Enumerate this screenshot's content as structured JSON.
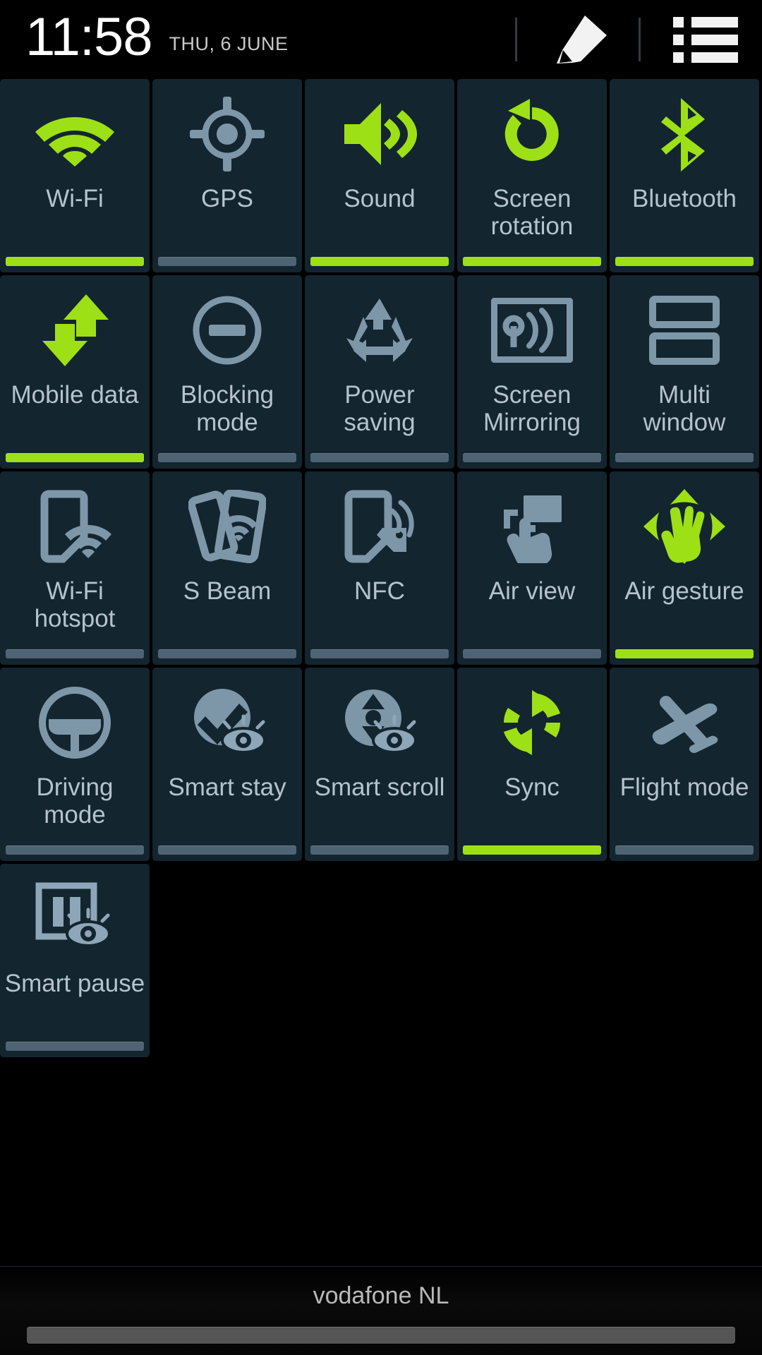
{
  "statusbar": {
    "time": "11:58",
    "date": "THU, 6 JUNE",
    "edit_icon": "pencil-icon",
    "list_icon": "list-icon"
  },
  "colors": {
    "accent_green": "#9ee016",
    "tile_background": "#13252f",
    "inactive_bar": "#4e6373",
    "label_text": "#b6c3cc",
    "screen_background": "#000000"
  },
  "tiles": [
    {
      "label": "Wi-Fi",
      "icon": "wifi-icon",
      "state": "on"
    },
    {
      "label": "GPS",
      "icon": "gps-icon",
      "state": "off"
    },
    {
      "label": "Sound",
      "icon": "sound-icon",
      "state": "on"
    },
    {
      "label": "Screen rotation",
      "icon": "screen-rotation-icon",
      "state": "on"
    },
    {
      "label": "Bluetooth",
      "icon": "bluetooth-icon",
      "state": "on"
    },
    {
      "label": "Mobile data",
      "icon": "mobile-data-icon",
      "state": "on"
    },
    {
      "label": "Blocking mode",
      "icon": "blocking-mode-icon",
      "state": "off"
    },
    {
      "label": "Power saving",
      "icon": "recycle-icon",
      "state": "off"
    },
    {
      "label": "Screen Mirroring",
      "icon": "screen-mirroring-icon",
      "state": "off"
    },
    {
      "label": "Multi window",
      "icon": "multi-window-icon",
      "state": "off"
    },
    {
      "label": "Wi-Fi hotspot",
      "icon": "wifi-hotspot-icon",
      "state": "off"
    },
    {
      "label": "S Beam",
      "icon": "s-beam-icon",
      "state": "off"
    },
    {
      "label": "NFC",
      "icon": "nfc-icon",
      "state": "off"
    },
    {
      "label": "Air view",
      "icon": "air-view-icon",
      "state": "off"
    },
    {
      "label": "Air gesture",
      "icon": "air-gesture-icon",
      "state": "on"
    },
    {
      "label": "Driving mode",
      "icon": "steering-wheel-icon",
      "state": "off"
    },
    {
      "label": "Smart stay",
      "icon": "smart-stay-icon",
      "state": "off"
    },
    {
      "label": "Smart scroll",
      "icon": "smart-scroll-icon",
      "state": "off"
    },
    {
      "label": "Sync",
      "icon": "sync-icon",
      "state": "on"
    },
    {
      "label": "Flight mode",
      "icon": "airplane-icon",
      "state": "off"
    },
    {
      "label": "Smart pause",
      "icon": "smart-pause-icon",
      "state": "off"
    }
  ],
  "bottom": {
    "carrier": "vodafone NL",
    "handle": "drag-handle"
  }
}
